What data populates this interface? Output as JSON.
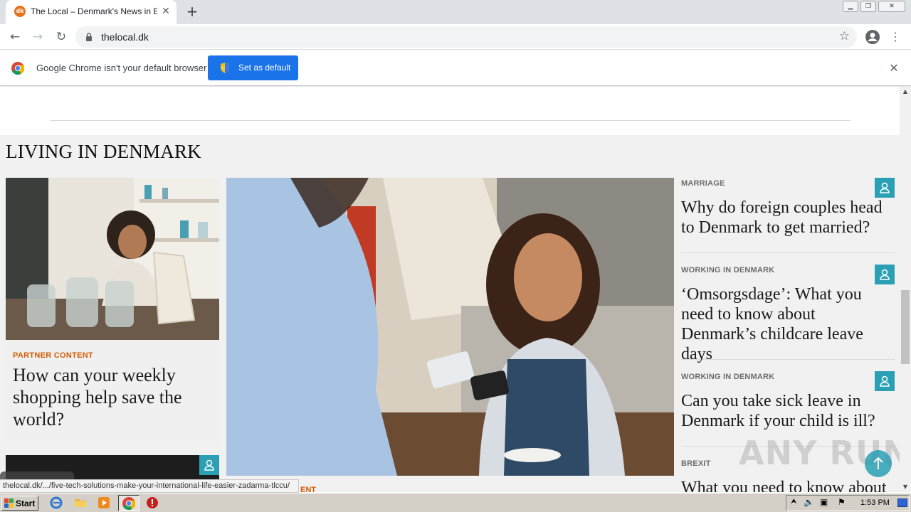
{
  "browser": {
    "tab": {
      "favicon_text": "dk",
      "title": "The Local – Denmark's News in English"
    },
    "address": {
      "url": "thelocal.dk"
    },
    "infobar": {
      "message": "Google Chrome isn't your default browser",
      "button_label": "Set as default"
    }
  },
  "page": {
    "section_title": "LIVING IN DENMARK",
    "left_card": {
      "kicker": "PARTNER CONTENT",
      "headline": "How can your weekly shopping help save the world?"
    },
    "hero_kicker_partial": "ENT",
    "sidebar": [
      {
        "kicker": "MARRIAGE",
        "headline": "Why do foreign couples head to Denmark to get married?"
      },
      {
        "kicker": "WORKING IN DENMARK",
        "headline": "‘Omsorgsdage’: What you need to know about Denmark’s childcare leave days"
      },
      {
        "kicker": "WORKING IN DENMARK",
        "headline": "Can you take sick leave in Denmark if your child is ill?"
      },
      {
        "kicker": "BREXIT",
        "headline": "What you need to know about"
      }
    ],
    "accent_colors": {
      "teal": "#2ba0b4",
      "orange": "#d55a00"
    }
  },
  "status_bar": {
    "link_preview": "thelocal.dk/.../five-tech-solutions-make-your-international-life-easier-zadarma-tlccu/"
  },
  "watermark": "ANY RUN",
  "taskbar": {
    "start_label": "Start",
    "clock": "1:53 PM"
  }
}
